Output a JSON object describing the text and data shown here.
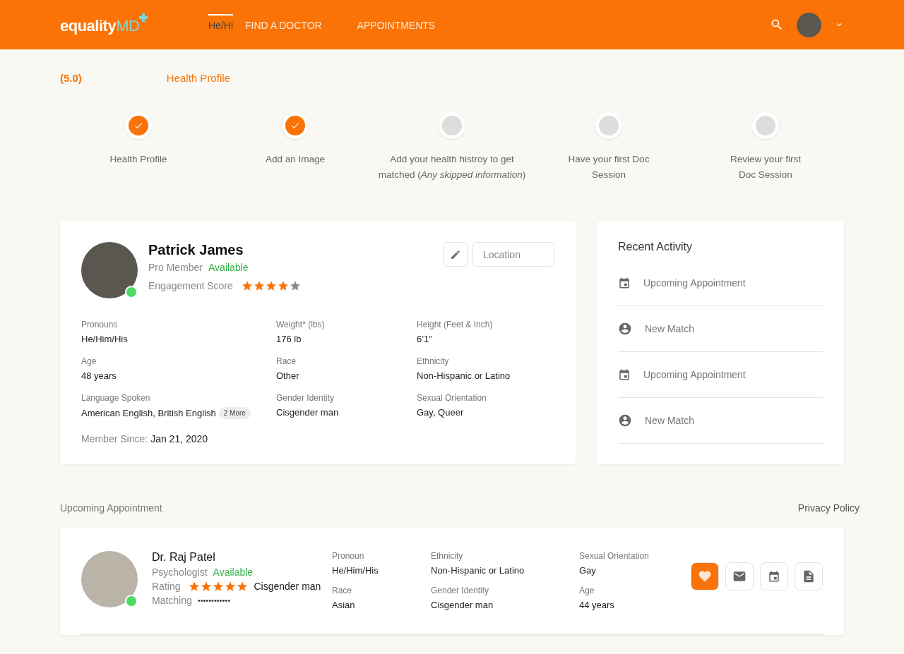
{
  "header": {
    "logo": {
      "main": "equality",
      "accent": "MD"
    },
    "nav": [
      {
        "label": "He/Hi",
        "selected": true
      },
      {
        "label": "FIND A DOCTOR",
        "selected": false
      },
      {
        "label": "APPOINTMENTS",
        "selected": false
      }
    ]
  },
  "subheader": {
    "rating": "(5.0)",
    "title": "Health Profile"
  },
  "steps": [
    {
      "label": "Health Profile",
      "completed": true
    },
    {
      "label": "Add an Image",
      "completed": true
    },
    {
      "label": "Add your health histroy to get matched (*Any skipped information*)",
      "completed": false
    },
    {
      "label": "Have your first Doc Session",
      "completed": false
    },
    {
      "label": "Review your first Doc Session",
      "completed": false
    }
  ],
  "profile": {
    "name": "Patrick James",
    "membership": "Pro Member",
    "status": "Available",
    "online": true,
    "score_label": "Engagement Score",
    "stars": 4,
    "location_placeholder": "Location",
    "fields": [
      {
        "label": "Pronouns",
        "value": "He/Him/His"
      },
      {
        "label": "Weight* (lbs)",
        "value": "176 lb"
      },
      {
        "label": "Height (Feet & Inch)",
        "value": "6’1”"
      },
      {
        "label": "Age",
        "value": "48 years"
      },
      {
        "label": "Race",
        "value": "Other"
      },
      {
        "label": "Ethnicity",
        "value": "Non-Hispanic or Latino"
      },
      {
        "label": "Language Spoken",
        "value": "American English, British English",
        "badge": "2 More"
      },
      {
        "label": "Gender Identity",
        "value": "Cisgender man"
      },
      {
        "label": "Sexual Orientation",
        "value": "Gay, Queer"
      }
    ],
    "member_since_label": "Member Since:",
    "member_since": "Jan 21, 2020"
  },
  "recent_activity": {
    "title": "Recent Activity",
    "items": [
      {
        "kind": "calendar",
        "label": "Upcoming Appointment"
      },
      {
        "kind": "person",
        "label": "New Match"
      },
      {
        "kind": "calendar",
        "label": "Upcoming Appointment"
      },
      {
        "kind": "person",
        "label": "New Match"
      }
    ]
  },
  "upcoming": {
    "title": "Upcoming Appointment",
    "privacy_link": "Privacy Policy",
    "doctor": {
      "name": "Dr. Raj Patel",
      "role": "Psychologist",
      "status": "Available",
      "online": true,
      "rating_label": "Rating",
      "stars": 5,
      "gender_note": "Cisgender man",
      "matching_label": "Matching",
      "matching_value": "••••••••••••",
      "columns": [
        [
          {
            "label": "Pronoun",
            "value": "He/Him/His"
          },
          {
            "label": "Race",
            "value": "Asian"
          }
        ],
        [
          {
            "label": "Ethnicity",
            "value": "Non-Hispanic or Latino"
          },
          {
            "label": "Gender Identity",
            "value": "Cisgender man"
          }
        ],
        [
          {
            "label": "Sexual Orientation",
            "value": "Gay"
          },
          {
            "label": "Age",
            "value": "44 years"
          }
        ]
      ],
      "actions": [
        {
          "kind": "favorite",
          "selected": true
        },
        {
          "kind": "mail",
          "selected": false
        },
        {
          "kind": "calendar",
          "selected": false
        },
        {
          "kind": "document",
          "selected": false
        }
      ]
    }
  }
}
